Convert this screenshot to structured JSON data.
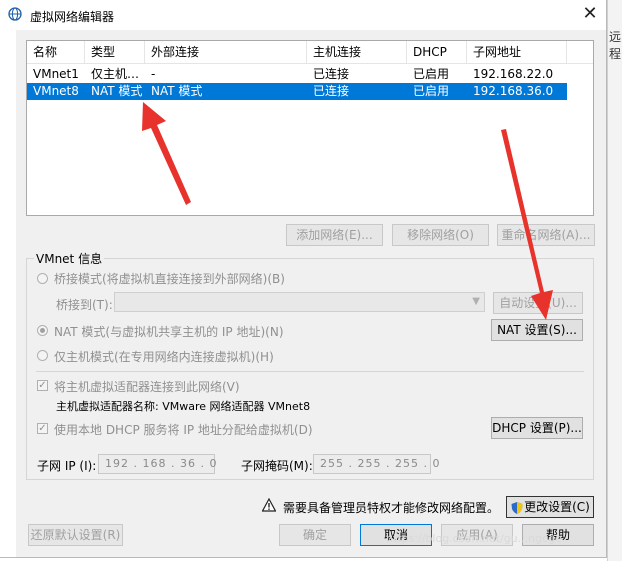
{
  "window": {
    "title": "虚拟网络编辑器",
    "close_glyph": "✕",
    "side_clip_text": "远程"
  },
  "network_list": {
    "columns": [
      "名称",
      "类型",
      "外部连接",
      "主机连接",
      "DHCP",
      "子网地址"
    ],
    "rows": [
      {
        "name": "VMnet1",
        "type": "仅主机…",
        "external": "-",
        "host": "已连接",
        "dhcp": "已启用",
        "subnet": "192.168.22.0",
        "selected": false
      },
      {
        "name": "VMnet8",
        "type": "NAT 模式",
        "external": "NAT 模式",
        "host": "已连接",
        "dhcp": "已启用",
        "subnet": "192.168.36.0",
        "selected": true
      }
    ],
    "selected_color": "#0078d7"
  },
  "list_buttons": {
    "add": "添加网络(E)...",
    "remove": "移除网络(O)",
    "rename": "重命名网络(A)..."
  },
  "vmnet_info": {
    "group_label": "VMnet 信息",
    "bridged_label": "桥接模式(将虚拟机直接连接到外部网络)(B)",
    "bridged_to_label": "桥接到(T):",
    "bridged_to_value": "",
    "auto_settings": "自动设置(U)...",
    "nat_label": "NAT 模式(与虚拟机共享主机的 IP 地址)(N)",
    "nat_settings": "NAT 设置(S)...",
    "hostonly_label": "仅主机模式(在专用网络内连接虚拟机)(H)",
    "connect_adapter_label": "将主机虚拟适配器连接到此网络(V)",
    "adapter_name_label": "主机虚拟适配器名称: VMware 网络适配器 VMnet8",
    "dhcp_label": "使用本地 DHCP 服务将 IP 地址分配给虚拟机(D)",
    "dhcp_settings": "DHCP 设置(P)...",
    "subnet_ip_label": "子网 IP (I):",
    "subnet_ip_value": "192 . 168 . 36 . 0",
    "subnet_mask_label": "子网掩码(M):",
    "subnet_mask_value": "255 . 255 . 255 . 0"
  },
  "footer": {
    "admin_notice": "需要具备管理员特权才能修改网络配置。",
    "change_settings": "更改设置(C)",
    "restore_defaults": "还原默认设置(R)",
    "ok": "确定",
    "cancel": "取消",
    "apply": "应用(A)",
    "help": "帮助",
    "watermark": "https://blog.csdn.net/gu...ngcge"
  },
  "icons": {
    "app": "network-globe-icon",
    "warning": "warning-triangle-icon",
    "shield": "uac-shield-icon"
  },
  "annotations_color": "#e8322c"
}
